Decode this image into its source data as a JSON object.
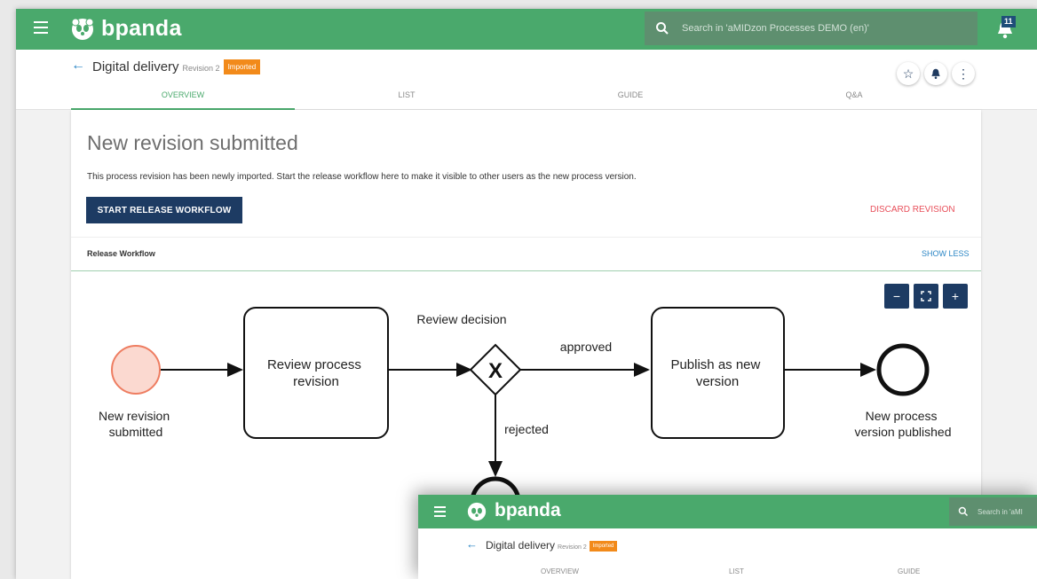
{
  "app": {
    "brand": "bpanda",
    "search": {
      "placeholder": "Search in 'aMIDzon Processes DEMO (en)'"
    },
    "notifications": {
      "count": "11"
    },
    "accent": "#4aa96c"
  },
  "header": {
    "title": "Digital delivery",
    "revision": "Revision 2",
    "tag": "Imported",
    "tabs": [
      {
        "label": "OVERVIEW",
        "active": true
      },
      {
        "label": "LIST",
        "active": false
      },
      {
        "label": "GUIDE",
        "active": false
      },
      {
        "label": "Q&A",
        "active": false
      }
    ],
    "actions": [
      "star-icon",
      "bell-icon",
      "more-vert-icon"
    ]
  },
  "card": {
    "title": "New revision submitted",
    "text": "This process revision has been newly imported. Start the release workflow here to make it visible to other users as the new process version.",
    "start_button": "START RELEASE WORKFLOW",
    "discard_link": "DISCARD REVISION",
    "workflow_label": "Release Workflow",
    "show_less": "SHOW LESS"
  },
  "zoom": {
    "minus": "−",
    "fit": "fit-screen-icon",
    "plus": "+"
  },
  "diagram": {
    "start_event": "New revision submitted",
    "task1": "Review process revision",
    "gateway": "Review decision",
    "gateway_symbol": "X",
    "flow_approved": "approved",
    "flow_rejected": "rejected",
    "task2": "Publish as new version",
    "end_event": "New process version published"
  },
  "overlay": {
    "brand": "bpanda",
    "search_text": "Search in 'aMI",
    "title": "Digital delivery",
    "revision": "Revision 2",
    "tag": "Imported",
    "tabs": [
      "OVERVIEW",
      "LIST",
      "GUIDE"
    ]
  }
}
